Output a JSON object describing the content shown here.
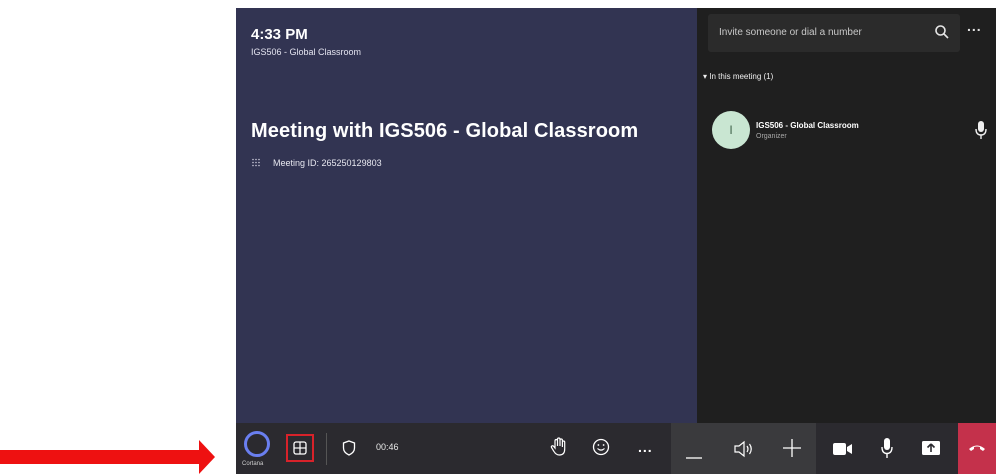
{
  "stage": {
    "time": "4:33 PM",
    "subtitle": "IGS506 - Global Classroom",
    "meeting_title": "Meeting with IGS506 - Global Classroom",
    "meeting_id": "Meeting ID: 265250129803"
  },
  "panel": {
    "invite_placeholder": "Invite someone or dial a number",
    "more_label": "...",
    "section_label": "In this meeting (1)",
    "participant": {
      "initial": "I",
      "name": "IGS506 - Global Classroom",
      "role": "Organizer"
    }
  },
  "toolbar": {
    "cortana_label": "Cortana",
    "timer": "00:46",
    "more_label": "..."
  },
  "colors": {
    "stage_bg": "#323452",
    "panel_bg": "#1f1f1f",
    "end_call": "#c4314b",
    "highlight_box": "#d8222a",
    "annotation_arrow": "#ee1111"
  }
}
